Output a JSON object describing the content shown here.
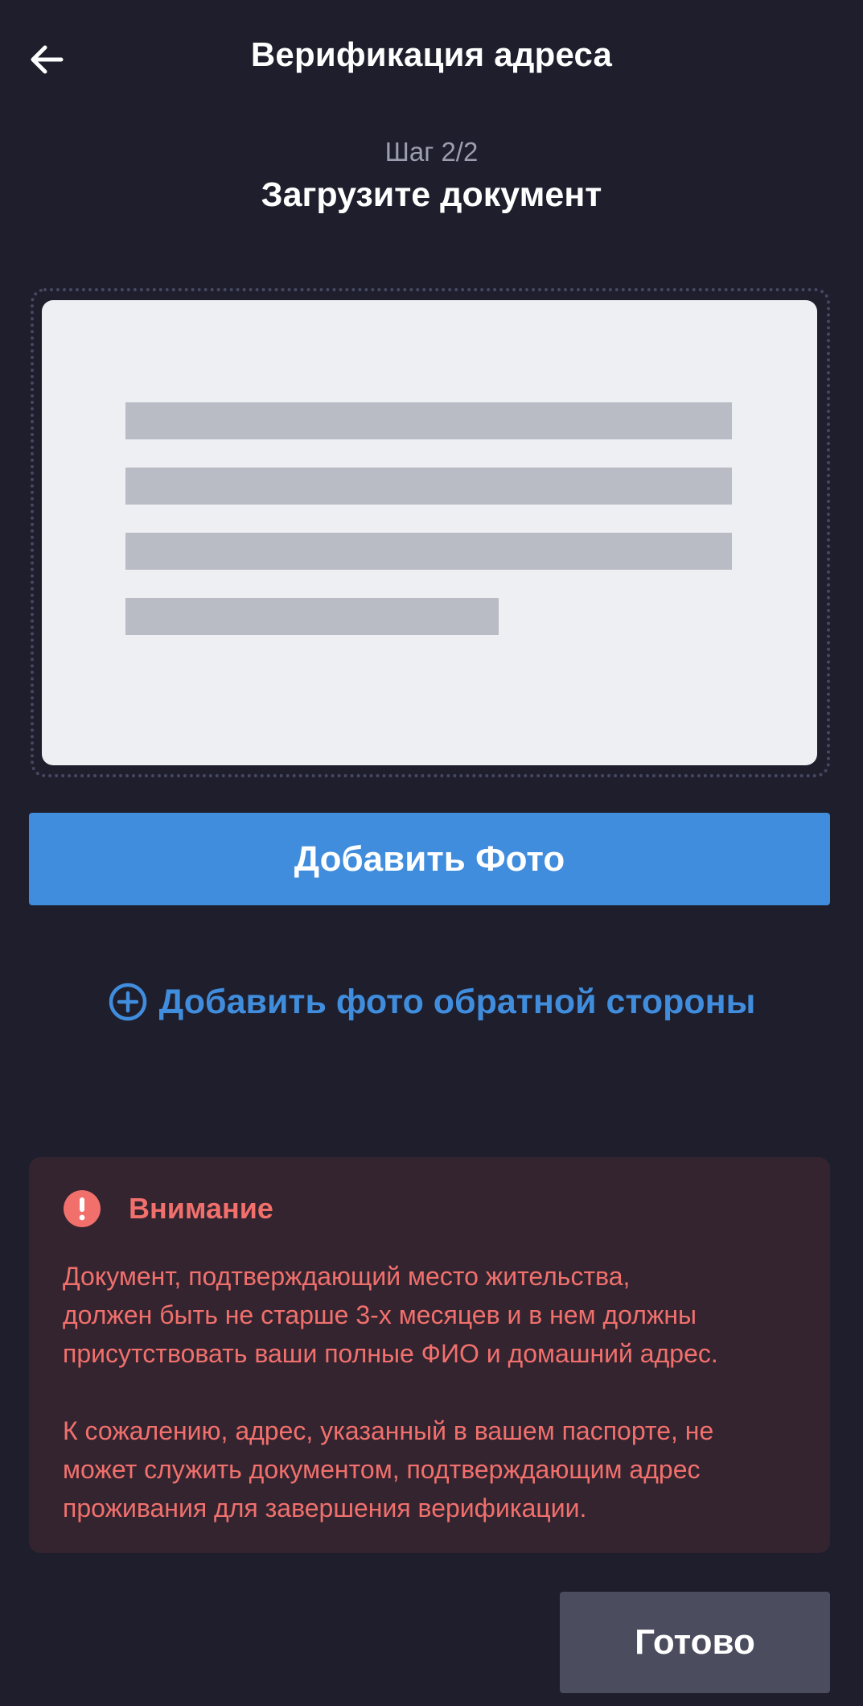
{
  "header": {
    "title": "Верификация адреса",
    "back_icon": "arrow-left-icon"
  },
  "step": {
    "counter": "Шаг 2/2",
    "title": "Загрузите документ"
  },
  "document_preview": {
    "icon": "document-placeholder-icon"
  },
  "actions": {
    "add_photo_label": "Добавить Фото",
    "add_back_label": "Добавить фото обратной стороны",
    "add_back_icon": "plus-circle-icon",
    "done_label": "Готово"
  },
  "warning": {
    "icon": "exclamation-circle-icon",
    "title": "Внимание",
    "paragraph1_lines": [
      "Документ, подтверждающий место жительства,",
      "должен быть не старше 3-х месяцев и в нем должны",
      "присутствовать ваши полные ФИО и домашний адрес."
    ],
    "paragraph2_lines": [
      "К сожалению, адрес, указанный в вашем паспорте, не",
      "может служить документом, подтверждающим адрес",
      "проживания для завершения верификации."
    ]
  },
  "colors": {
    "background": "#1e1e2c",
    "accent_blue": "#418ddd",
    "warning_red": "#f1706c",
    "warning_bg": "#332430",
    "done_bg": "#4b4c5e"
  }
}
